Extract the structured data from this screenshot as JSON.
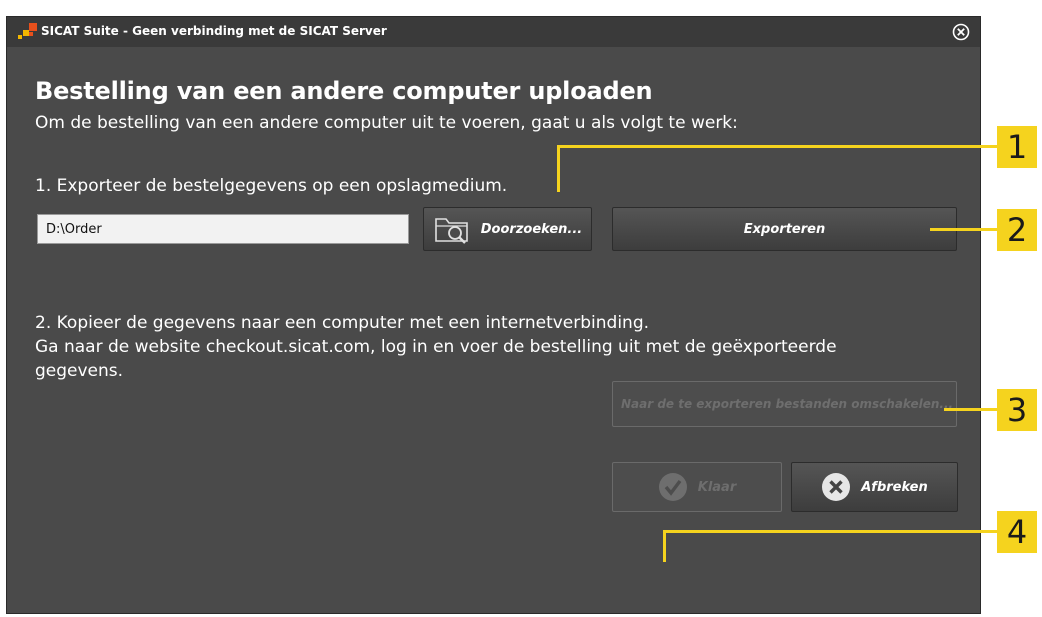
{
  "window": {
    "title": "SICAT Suite - Geen verbinding met de SICAT Server"
  },
  "dialog": {
    "heading": "Bestelling van een andere computer uploaden",
    "intro": "Om de bestelling van een andere computer uit te voeren, gaat u als volgt te werk:",
    "step1": "1. Exporteer de bestelgegevens op een opslagmedium.",
    "path_value": "D:\\Order",
    "browse_label": "Doorzoeken...",
    "export_label": "Exporteren",
    "step2_line1": "2. Kopieer de gegevens naar een computer met een internetverbinding.",
    "step2_line2": "Ga naar de website checkout.sicat.com, log in en voer de bestelling uit met de geëxporteerde",
    "step2_line3": "gegevens.",
    "switch_label": "Naar de te exporteren bestanden omschakelen...",
    "done_label": "Klaar",
    "cancel_label": "Afbreken"
  },
  "callouts": [
    "1",
    "2",
    "3",
    "4"
  ],
  "colors": {
    "callout": "#f5d31e",
    "window_bg": "#4a4a4a",
    "titlebar_bg": "#3a3a3a"
  }
}
